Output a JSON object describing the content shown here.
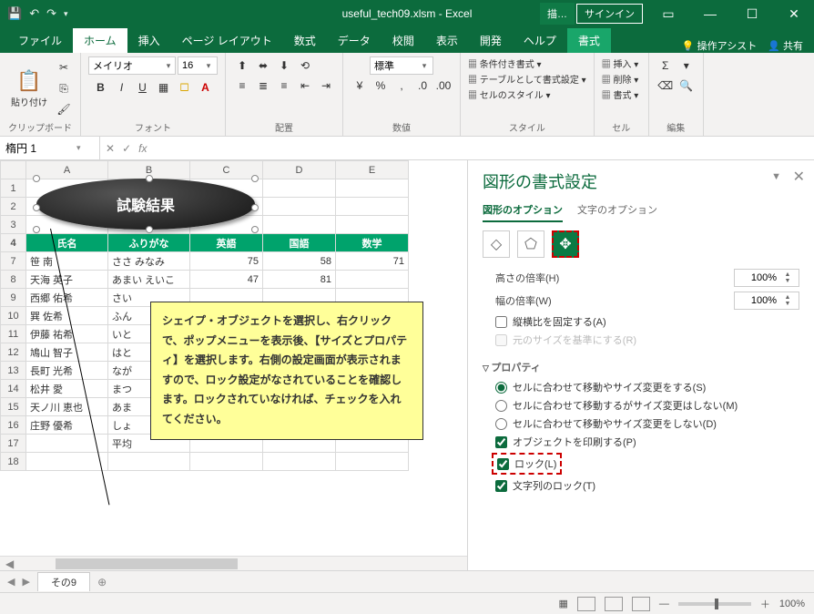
{
  "titlebar": {
    "filename": "useful_tech09.xlsm  -  Excel",
    "signin": "サインイン",
    "context_tool": "描…"
  },
  "tabs": {
    "file": "ファイル",
    "home": "ホーム",
    "insert": "挿入",
    "pagelayout": "ページ レイアウト",
    "formulas": "数式",
    "data": "データ",
    "review": "校閲",
    "view": "表示",
    "developer": "開発",
    "help": "ヘルプ",
    "format": "書式",
    "tell": "操作アシスト",
    "share": "共有"
  },
  "ribbon": {
    "clipboard": {
      "label": "クリップボード",
      "paste": "貼り付け"
    },
    "font": {
      "label": "フォント",
      "name": "メイリオ",
      "size": "16"
    },
    "align": {
      "label": "配置",
      "wrap": "標準"
    },
    "number": {
      "label": "数値"
    },
    "styles": {
      "label": "スタイル",
      "cond": "条件付き書式",
      "table": "テーブルとして書式設定",
      "cell": "セルのスタイル"
    },
    "cells": {
      "label": "セル",
      "ins": "挿入",
      "del": "削除",
      "fmt": "書式"
    },
    "editing": {
      "label": "編集"
    }
  },
  "namebox": "楕円 1",
  "columns": [
    "",
    "A",
    "B",
    "C",
    "D",
    "E"
  ],
  "rows": [
    {
      "n": "1",
      "c": [
        "",
        "",
        "",
        "",
        ""
      ]
    },
    {
      "n": "2",
      "c": [
        "",
        "",
        "",
        "",
        ""
      ]
    },
    {
      "n": "3",
      "c": [
        "",
        "",
        "",
        "",
        ""
      ]
    },
    {
      "n": "4",
      "hdr": true,
      "c": [
        "氏名",
        "ふりがな",
        "英語",
        "国語",
        "数学"
      ]
    },
    {
      "n": "7",
      "c": [
        "笹 南",
        "ささ みなみ",
        "75",
        "58",
        "71"
      ]
    },
    {
      "n": "8",
      "c": [
        "天海 英子",
        "あまい えいこ",
        "47",
        "81",
        ""
      ]
    },
    {
      "n": "9",
      "c": [
        "西郷 佑希",
        "さい",
        "",
        "",
        ""
      ]
    },
    {
      "n": "10",
      "c": [
        "巽 佐希",
        "ふん",
        "",
        "",
        ""
      ]
    },
    {
      "n": "11",
      "c": [
        "伊藤 祐希",
        "いと",
        "",
        "",
        ""
      ]
    },
    {
      "n": "12",
      "c": [
        "鳩山 智子",
        "はと",
        "",
        "",
        ""
      ]
    },
    {
      "n": "13",
      "c": [
        "長町 光希",
        "なが",
        "",
        "",
        ""
      ]
    },
    {
      "n": "14",
      "c": [
        "松井 愛",
        "まつ",
        "",
        "",
        ""
      ]
    },
    {
      "n": "15",
      "c": [
        "天ノ川 恵也",
        "あま",
        "",
        "",
        ""
      ]
    },
    {
      "n": "16",
      "c": [
        "庄野 優希",
        "しょ",
        "",
        "",
        ""
      ]
    },
    {
      "n": "17",
      "c": [
        "",
        "平均",
        "",
        "",
        ""
      ]
    },
    {
      "n": "18",
      "c": [
        "",
        "",
        "",
        "",
        ""
      ]
    }
  ],
  "shape_text": "試験結果",
  "callout": "シェイプ・オブジェクトを選択し、右クリックで、ポップメニューを表示後、【サイズとプロパティ】を選択します。右側の設定画面が表示されますので、ロック設定がなされていることを確認します。ロックされていなければ、チェックを入れてください。",
  "pane": {
    "title": "図形の書式設定",
    "tab_shape": "図形のオプション",
    "tab_text": "文字のオプション",
    "size": {
      "height_scale": "高さの倍率(H)",
      "width_scale": "幅の倍率(W)",
      "hval": "100%",
      "wval": "100%",
      "lock_aspect": "縦横比を固定する(A)",
      "original": "元のサイズを基準にする(R)"
    },
    "prop": {
      "title": "プロパティ",
      "r1": "セルに合わせて移動やサイズ変更をする(S)",
      "r2": "セルに合わせて移動するがサイズ変更はしない(M)",
      "r3": "セルに合わせて移動やサイズ変更をしない(D)",
      "print": "オブジェクトを印刷する(P)",
      "lock": "ロック(L)",
      "locktext": "文字列のロック(T)"
    }
  },
  "sheettab": "その9",
  "zoom": "100%"
}
